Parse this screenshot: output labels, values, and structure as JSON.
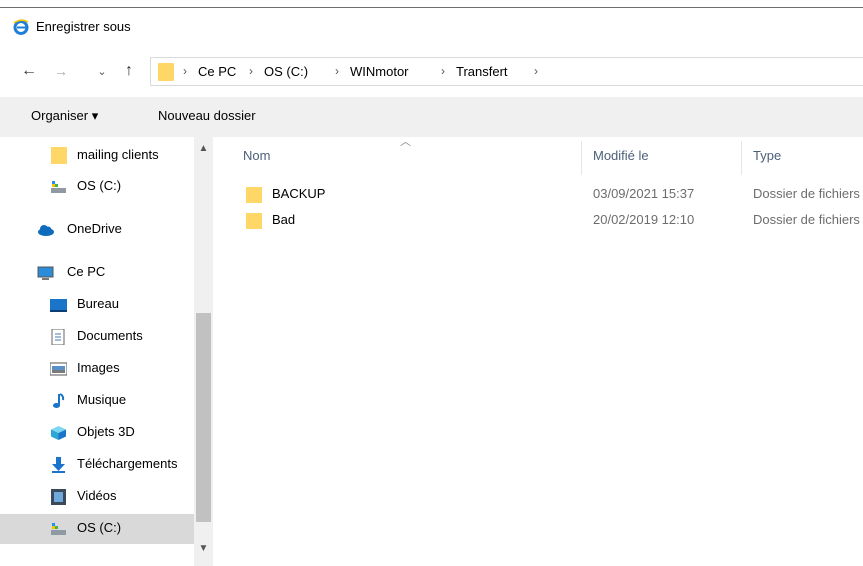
{
  "window": {
    "title": "Enregistrer sous"
  },
  "nav": {
    "back": "←",
    "forward": "→",
    "recent": "⌄",
    "up": "↑"
  },
  "breadcrumb": [
    "Ce PC",
    "OS (C:)",
    "WINmotor",
    "Transfert"
  ],
  "toolbar": {
    "organize": "Organiser ▾",
    "new_folder": "Nouveau dossier"
  },
  "sidebar": {
    "items": [
      {
        "label": "mailing clients",
        "icon": "folder-icon"
      },
      {
        "label": "OS (C:)",
        "icon": "drive-icon"
      },
      {
        "label": "OneDrive",
        "icon": "cloud-icon"
      },
      {
        "label": "Ce PC",
        "icon": "computer-icon"
      },
      {
        "label": "Bureau",
        "icon": "desktop-icon"
      },
      {
        "label": "Documents",
        "icon": "documents-icon"
      },
      {
        "label": "Images",
        "icon": "pictures-icon"
      },
      {
        "label": "Musique",
        "icon": "music-icon"
      },
      {
        "label": "Objets 3D",
        "icon": "3d-objects-icon"
      },
      {
        "label": "Téléchargements",
        "icon": "downloads-icon"
      },
      {
        "label": "Vidéos",
        "icon": "videos-icon"
      },
      {
        "label": "OS (C:)",
        "icon": "drive-icon",
        "selected": true
      }
    ]
  },
  "columns": {
    "name": "Nom",
    "modified": "Modifié le",
    "type": "Type"
  },
  "files": [
    {
      "name": "BACKUP",
      "modified": "03/09/2021 15:37",
      "type": "Dossier de fichiers"
    },
    {
      "name": "Bad",
      "modified": "20/02/2019 12:10",
      "type": "Dossier de fichiers"
    }
  ],
  "colors": {
    "folder": "#ffd767",
    "toolbar_bg": "#f0f0f0",
    "selected_bg": "#d9d9d9",
    "header_text": "#4c607a"
  }
}
